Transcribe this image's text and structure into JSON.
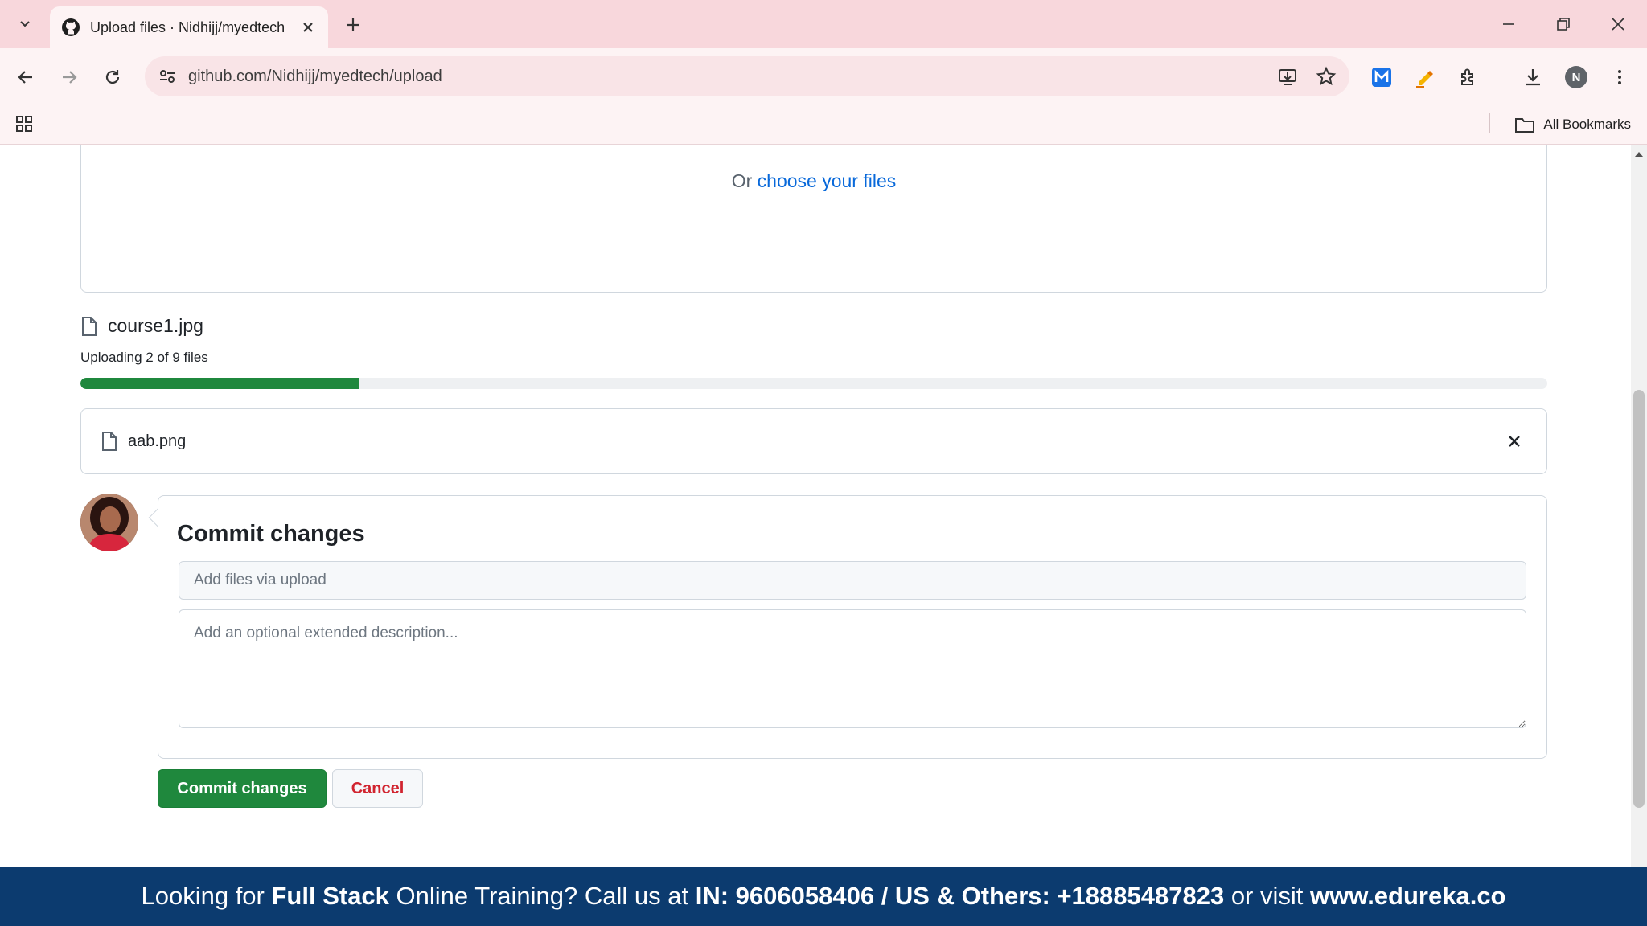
{
  "browser": {
    "tab_title": "Upload files · Nidhijj/myedtech",
    "url": "github.com/Nidhijj/myedtech/upload",
    "bookmarks_label": "All Bookmarks",
    "profile_initial": "N"
  },
  "dropzone": {
    "or_text": "Or ",
    "choose_link": "choose your files"
  },
  "upload": {
    "current_file": "course1.jpg",
    "status": "Uploading 2 of 9 files",
    "progress_fraction": 0.19
  },
  "files": [
    {
      "name": "aab.png"
    }
  ],
  "commit": {
    "title": "Commit changes",
    "summary_placeholder": "Add files via upload",
    "description_placeholder": "Add an optional extended description...",
    "commit_button": "Commit changes",
    "cancel_button": "Cancel"
  },
  "banner": {
    "part1": "Looking for ",
    "bold1": "Full Stack",
    "part2": " Online Training? Call us at ",
    "bold2": "IN: 9606058406 / US & Others: +18885487823",
    "part3": " or visit ",
    "bold3": "www.edureka.co"
  },
  "colors": {
    "accent_green": "#1f883d",
    "link_blue": "#0969da",
    "danger_red": "#d1242f",
    "banner_blue": "#0c3b6f",
    "chrome_pink": "#f8d7dc"
  },
  "icons": [
    "tab-search-icon",
    "github-icon",
    "close-icon",
    "plus-icon",
    "minimize-icon",
    "restore-icon",
    "back-icon",
    "forward-icon",
    "reload-icon",
    "site-settings-icon",
    "install-app-icon",
    "star-icon",
    "extension-m-icon",
    "highlighter-icon",
    "puzzle-icon",
    "download-icon",
    "kebab-menu-icon",
    "apps-grid-icon",
    "folder-icon",
    "file-icon",
    "remove-icon"
  ]
}
